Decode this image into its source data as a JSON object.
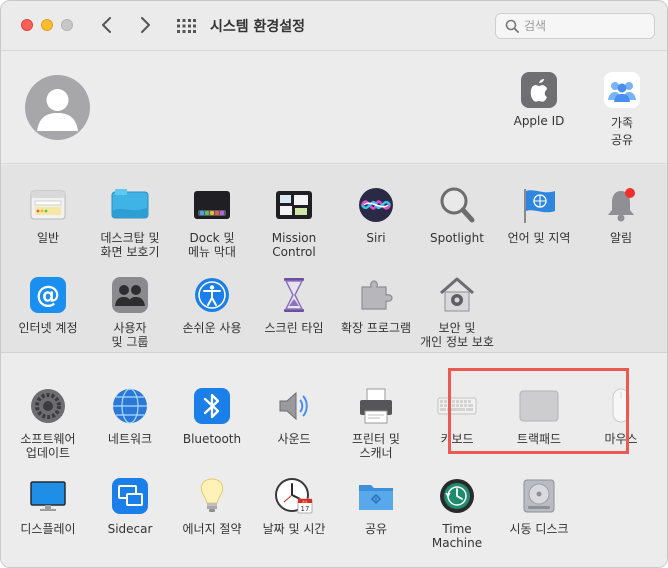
{
  "window": {
    "title": "시스템 환경설정",
    "search_placeholder": "검색"
  },
  "account": {
    "apple_id_label": "Apple ID",
    "family_line1": "가족",
    "family_line2": "공유"
  },
  "row1": [
    {
      "line1": "일반",
      "line2": "",
      "icon": "general-icon"
    },
    {
      "line1": "데스크탑 및",
      "line2": "화면 보호기",
      "icon": "desktop-icon"
    },
    {
      "line1": "Dock 및",
      "line2": "메뉴 막대",
      "icon": "dock-icon"
    },
    {
      "line1": "Mission",
      "line2": "Control",
      "icon": "mission-control-icon"
    },
    {
      "line1": "Siri",
      "line2": "",
      "icon": "siri-icon"
    },
    {
      "line1": "Spotlight",
      "line2": "",
      "icon": "spotlight-icon"
    },
    {
      "line1": "언어 및 지역",
      "line2": "",
      "icon": "language-icon"
    },
    {
      "line1": "알림",
      "line2": "",
      "icon": "notifications-icon"
    }
  ],
  "row2": [
    {
      "line1": "인터넷 계정",
      "line2": "",
      "icon": "internet-accounts-icon"
    },
    {
      "line1": "사용자",
      "line2": "및 그룹",
      "icon": "users-icon"
    },
    {
      "line1": "손쉬운 사용",
      "line2": "",
      "icon": "accessibility-icon"
    },
    {
      "line1": "스크린 타임",
      "line2": "",
      "icon": "screen-time-icon"
    },
    {
      "line1": "확장 프로그램",
      "line2": "",
      "icon": "extensions-icon"
    },
    {
      "line1": "보안 및",
      "line2": "개인 정보 보호",
      "icon": "security-icon"
    }
  ],
  "row3": [
    {
      "line1": "소프트웨어",
      "line2": "업데이트",
      "icon": "software-update-icon"
    },
    {
      "line1": "네트워크",
      "line2": "",
      "icon": "network-icon"
    },
    {
      "line1": "Bluetooth",
      "line2": "",
      "icon": "bluetooth-icon"
    },
    {
      "line1": "사운드",
      "line2": "",
      "icon": "sound-icon"
    },
    {
      "line1": "프린터 및",
      "line2": "스캐너",
      "icon": "printer-icon"
    },
    {
      "line1": "키보드",
      "line2": "",
      "icon": "keyboard-icon"
    },
    {
      "line1": "트랙패드",
      "line2": "",
      "icon": "trackpad-icon"
    },
    {
      "line1": "마우스",
      "line2": "",
      "icon": "mouse-icon"
    }
  ],
  "row4": [
    {
      "line1": "디스플레이",
      "line2": "",
      "icon": "display-icon"
    },
    {
      "line1": "Sidecar",
      "line2": "",
      "icon": "sidecar-icon"
    },
    {
      "line1": "에너지 절약",
      "line2": "",
      "icon": "energy-saver-icon"
    },
    {
      "line1": "날짜 및 시간",
      "line2": "",
      "icon": "date-time-icon"
    },
    {
      "line1": "공유",
      "line2": "",
      "icon": "sharing-icon"
    },
    {
      "line1": "Time",
      "line2": "Machine",
      "icon": "time-machine-icon"
    },
    {
      "line1": "시동 디스크",
      "line2": "",
      "icon": "startup-disk-icon"
    }
  ],
  "calendar_badge": {
    "month": "JUL",
    "day": "17"
  },
  "colors": {
    "highlight": "#ea5a50",
    "close": "#fe5f57",
    "minimize": "#febc2e"
  }
}
